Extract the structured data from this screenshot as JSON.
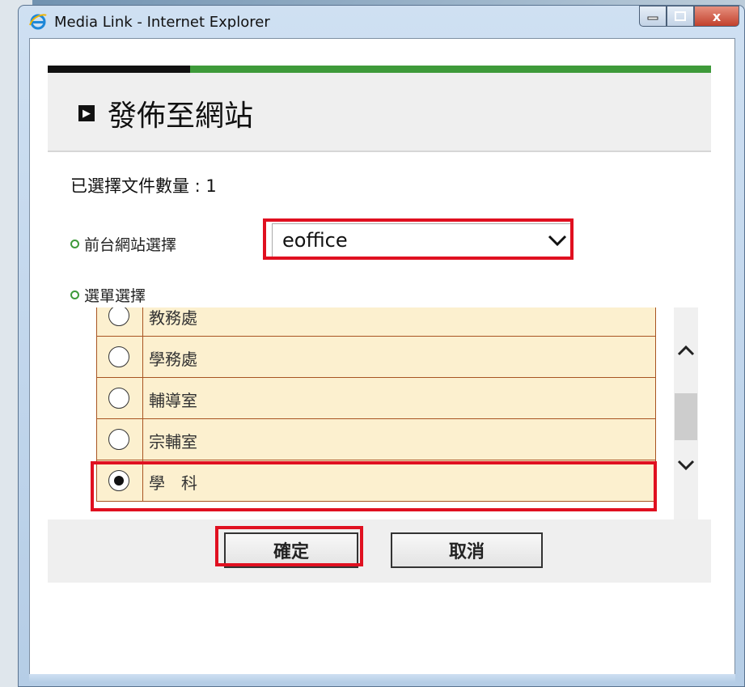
{
  "window": {
    "title": "Media Link - Internet Explorer",
    "controls": {
      "minimize": "minimize",
      "maximize": "maximize",
      "close": "x"
    }
  },
  "header": {
    "title": "發佈至網站"
  },
  "selection": {
    "count_label": "已選擇文件數量 : 1"
  },
  "site_select": {
    "label": "前台網站選擇",
    "value": "eoffice"
  },
  "menu_select": {
    "label": "選單選擇",
    "items": [
      {
        "label": "教務處",
        "checked": false
      },
      {
        "label": "學務處",
        "checked": false
      },
      {
        "label": "輔導室",
        "checked": false
      },
      {
        "label": "宗輔室",
        "checked": false
      },
      {
        "label": "學　科",
        "checked": true
      }
    ]
  },
  "buttons": {
    "confirm": "確定",
    "cancel": "取消"
  },
  "colors": {
    "accent_green": "#3e9a3a",
    "highlight_red": "#e01020",
    "row_bg": "#fcf0cf",
    "row_border": "#a85422"
  },
  "icons": {
    "header": "square-arrow-icon",
    "browser": "ie-icon"
  }
}
